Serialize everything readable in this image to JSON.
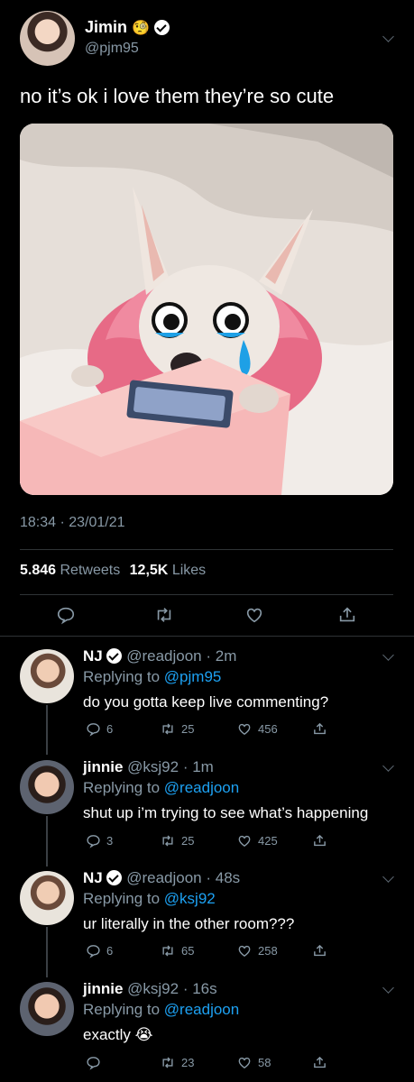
{
  "main_tweet": {
    "display_name": "Jimin",
    "name_emoji": "🧐",
    "handle": "@pjm95",
    "text": "no it’s ok i love them they’re so cute",
    "time": "18:34 · 23/01/21",
    "retweets_count": "5.846",
    "retweets_label": "Retweets",
    "likes_count": "12,5K",
    "likes_label": "Likes"
  },
  "replies": [
    {
      "name": "NJ",
      "verified": true,
      "handle": "@readjoon",
      "time": "· 2m",
      "replying_label": "Replying to",
      "replying_to": "@pjm95",
      "text": "do you gotta keep live commenting?",
      "reply_count": "6",
      "retweet_count": "25",
      "like_count": "456"
    },
    {
      "name": "jinnie",
      "verified": false,
      "handle": "@ksj92",
      "time": "· 1m",
      "replying_label": "Replying to",
      "replying_to": "@readjoon",
      "text": "shut up i’m trying to see what’s happening",
      "reply_count": "3",
      "retweet_count": "25",
      "like_count": "425"
    },
    {
      "name": "NJ",
      "verified": true,
      "handle": "@readjoon",
      "time": "· 48s",
      "replying_label": "Replying to",
      "replying_to": "@ksj92",
      "text": "ur literally in the other room???",
      "reply_count": "6",
      "retweet_count": "65",
      "like_count": "258"
    },
    {
      "name": "jinnie",
      "verified": false,
      "handle": "@ksj92",
      "time": "· 16s",
      "replying_label": "Replying to",
      "replying_to": "@readjoon",
      "text": "exactly",
      "text_emoji": "😭",
      "reply_count": "",
      "retweet_count": "23",
      "like_count": "58"
    }
  ],
  "colors": {
    "background": "#000000",
    "link": "#1da1f2",
    "muted": "#8899a6",
    "divider": "#2f3336"
  },
  "icons": [
    "reply-icon",
    "retweet-icon",
    "like-icon",
    "share-icon",
    "verified-icon",
    "chevron-down-icon"
  ]
}
